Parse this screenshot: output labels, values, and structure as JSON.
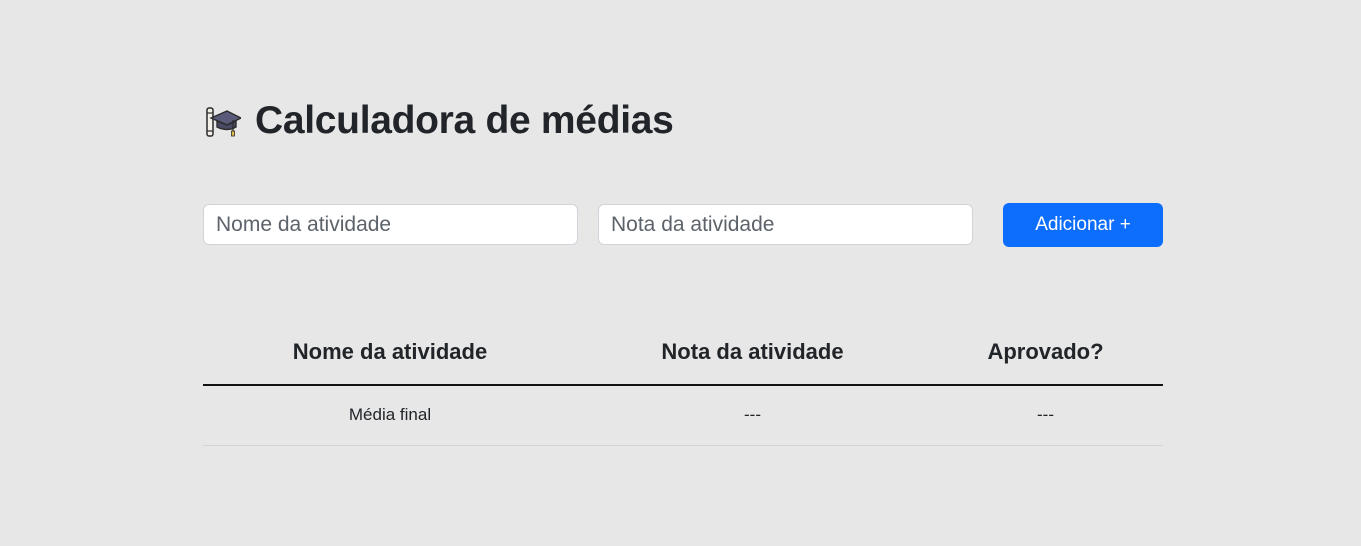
{
  "header": {
    "icon": "graduation-cap-with-diploma-icon",
    "title": "Calculadora de médias"
  },
  "form": {
    "name_input": {
      "placeholder": "Nome da atividade",
      "value": ""
    },
    "grade_input": {
      "placeholder": "Nota da atividade",
      "value": ""
    },
    "add_button_label": "Adicionar +"
  },
  "table": {
    "headers": [
      "Nome da atividade",
      "Nota da atividade",
      "Aprovado?"
    ],
    "footer_row": [
      "Média final",
      "---",
      "---"
    ]
  },
  "colors": {
    "background": "#e7e7e7",
    "primary_button": "#0d6efd",
    "text": "#212529"
  }
}
